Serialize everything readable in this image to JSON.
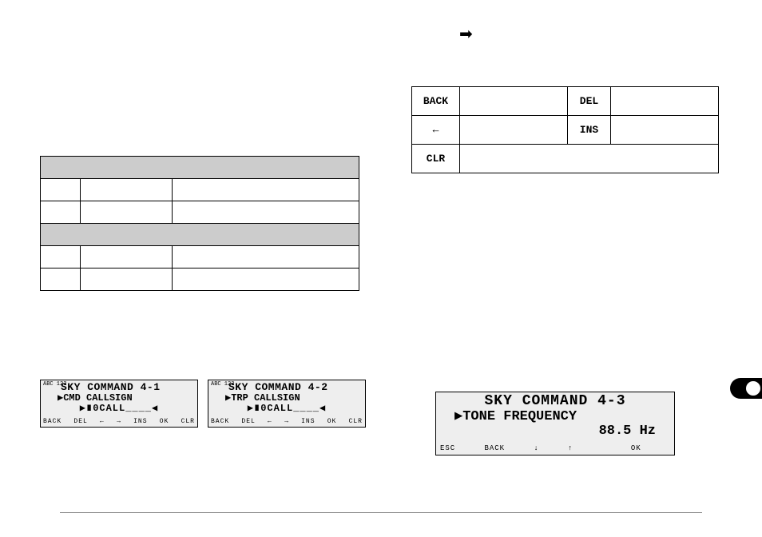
{
  "arrow": "➡",
  "right_table": {
    "rows": [
      {
        "k1": "BACK",
        "k2": "",
        "k3": "DEL",
        "k4": ""
      },
      {
        "k1": "←",
        "k2": "",
        "k3": "INS",
        "k4": ""
      },
      {
        "k1": "CLR",
        "k2": "",
        "k3": "",
        "k4": ""
      }
    ]
  },
  "left_table": {
    "rows": [
      {
        "c1": "",
        "c2": "",
        "c3": "",
        "shaded": true,
        "merged": true
      },
      {
        "c1": "",
        "c2": "",
        "c3": "",
        "shaded": false
      },
      {
        "c1": "",
        "c2": "",
        "c3": "",
        "shaded": false
      },
      {
        "c1": "",
        "c2": "",
        "c3": "",
        "shaded": true,
        "merged": true
      },
      {
        "c1": "",
        "c2": "",
        "c3": "",
        "shaded": false
      },
      {
        "c1": "",
        "c2": "",
        "c3": "",
        "shaded": false
      }
    ]
  },
  "lcd1": {
    "corner": "ABC\n123",
    "title": "SKY COMMAND 4-1",
    "line2": "▶CMD CALLSIGN",
    "line3": "▶∎0CALL____◀",
    "softkeys": [
      "BACK",
      "DEL",
      "←",
      "→",
      "INS",
      "OK",
      "CLR"
    ]
  },
  "lcd2": {
    "corner": "ABC\n123",
    "title": "SKY COMMAND 4-2",
    "line2": "▶TRP CALLSIGN",
    "line3": "▶∎0CALL____◀",
    "softkeys": [
      "BACK",
      "DEL",
      "←",
      "→",
      "INS",
      "OK",
      "CLR"
    ]
  },
  "lcd3": {
    "title": "SKY COMMAND 4-3",
    "line2": "▶TONE FREQUENCY",
    "line3": "88.5 Hz",
    "softkeys": [
      "ESC",
      "BACK",
      "↓",
      "↑",
      "",
      "OK",
      ""
    ]
  }
}
